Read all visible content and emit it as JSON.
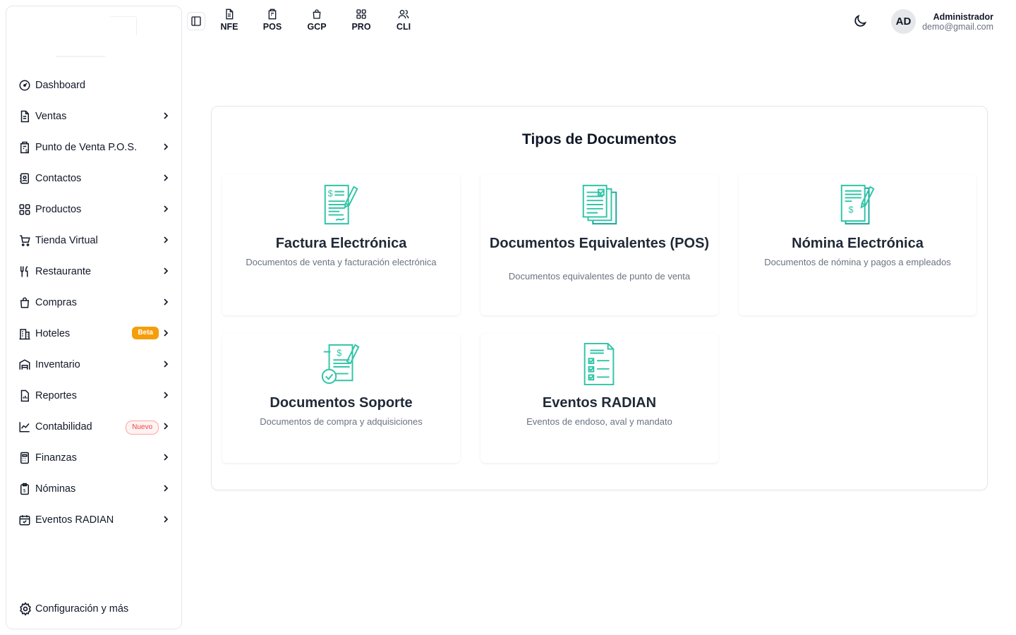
{
  "top_tabs": [
    {
      "label": "NFE",
      "icon": "document-icon"
    },
    {
      "label": "POS",
      "icon": "receipt-dollar-icon"
    },
    {
      "label": "GCP",
      "icon": "shopping-bag-icon"
    },
    {
      "label": "PRO",
      "icon": "grid-icon"
    },
    {
      "label": "CLI",
      "icon": "users-icon"
    }
  ],
  "user": {
    "initials": "AD",
    "name": "Administrador",
    "email": "demo@gmail.com"
  },
  "sidebar": {
    "items": [
      {
        "label": "Dashboard",
        "icon": "gauge-icon",
        "chevron": false
      },
      {
        "label": "Ventas",
        "icon": "document-icon",
        "chevron": true
      },
      {
        "label": "Punto de Venta P.O.S.",
        "icon": "receipt-dollar-icon",
        "chevron": true
      },
      {
        "label": "Contactos",
        "icon": "contact-book-icon",
        "chevron": true
      },
      {
        "label": "Productos",
        "icon": "grid-icon",
        "chevron": true
      },
      {
        "label": "Tienda Virtual",
        "icon": "cart-icon",
        "chevron": true
      },
      {
        "label": "Restaurante",
        "icon": "utensils-icon",
        "chevron": true
      },
      {
        "label": "Compras",
        "icon": "shopping-bag-icon",
        "chevron": true
      },
      {
        "label": "Hoteles",
        "icon": "building-icon",
        "chevron": true,
        "badge": "Beta"
      },
      {
        "label": "Inventario",
        "icon": "warehouse-icon",
        "chevron": true
      },
      {
        "label": "Reportes",
        "icon": "report-icon",
        "chevron": true
      },
      {
        "label": "Contabilidad",
        "icon": "chart-line-icon",
        "chevron": true,
        "badge": "Nuevo"
      },
      {
        "label": "Finanzas",
        "icon": "calculator-icon",
        "chevron": true
      },
      {
        "label": "Nóminas",
        "icon": "clipboard-dollar-icon",
        "chevron": true
      },
      {
        "label": "Eventos RADIAN",
        "icon": "calendar-check-icon",
        "chevron": true
      }
    ],
    "config_label": "Configuración y más"
  },
  "main": {
    "title": "Tipos de Documentos",
    "cards": [
      {
        "title": "Factura Electrónica",
        "description": "Documentos de venta y facturación electrónica",
        "icon": "invoice-pen-icon"
      },
      {
        "title": "Documentos Equivalentes (POS)",
        "description": "Documentos equivalentes de punto de venta",
        "icon": "documents-stack-icon"
      },
      {
        "title": "Nómina Electrónica",
        "description": "Documentos de nómina y pagos a empleados",
        "icon": "payroll-pen-icon"
      },
      {
        "title": "Documentos Soporte",
        "description": "Documentos de compra y adquisiciones",
        "icon": "support-document-icon"
      },
      {
        "title": "Eventos RADIAN",
        "description": "Eventos de endoso, aval y mandato",
        "icon": "checklist-document-icon"
      }
    ]
  },
  "colors": {
    "accent": "#2fc4a7",
    "beta_badge": "#f59e0b",
    "new_badge": "#ef4444"
  }
}
